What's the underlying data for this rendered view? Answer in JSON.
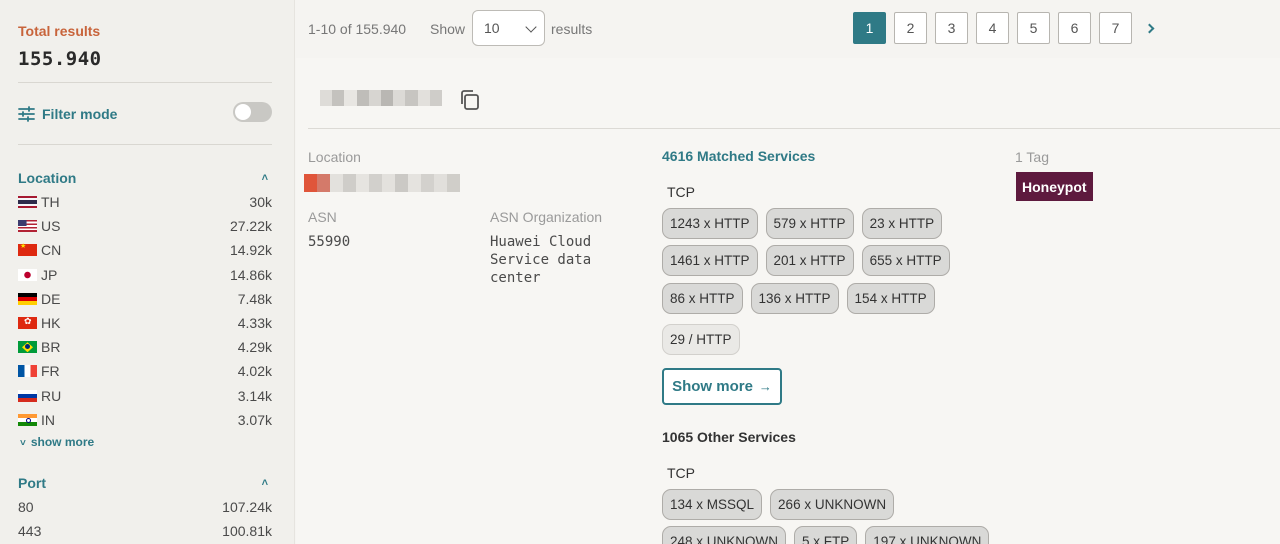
{
  "sidebar": {
    "total_label": "Total results",
    "total_value": "155.940",
    "filter_mode_label": "Filter mode",
    "location": {
      "title": "Location",
      "items": [
        {
          "code": "TH",
          "count": "30k",
          "flag": "fl-th"
        },
        {
          "code": "US",
          "count": "27.22k",
          "flag": "fl-us"
        },
        {
          "code": "CN",
          "count": "14.92k",
          "flag": "fl-cn"
        },
        {
          "code": "JP",
          "count": "14.86k",
          "flag": "fl-jp"
        },
        {
          "code": "DE",
          "count": "7.48k",
          "flag": "fl-de"
        },
        {
          "code": "HK",
          "count": "4.33k",
          "flag": "fl-hk"
        },
        {
          "code": "BR",
          "count": "4.29k",
          "flag": "fl-br"
        },
        {
          "code": "FR",
          "count": "4.02k",
          "flag": "fl-fr"
        },
        {
          "code": "RU",
          "count": "3.14k",
          "flag": "fl-ru"
        },
        {
          "code": "IN",
          "count": "3.07k",
          "flag": "fl-in"
        }
      ],
      "show_more": "show more"
    },
    "port": {
      "title": "Port",
      "items": [
        {
          "code": "80",
          "count": "107.24k"
        },
        {
          "code": "443",
          "count": "100.81k"
        }
      ]
    }
  },
  "toolbar": {
    "range": "1-10 of 155.940",
    "show_label": "Show",
    "per_page": "10",
    "results_label": "results",
    "pages": [
      "1",
      "2",
      "3",
      "4",
      "5",
      "6",
      "7"
    ],
    "current_page": "1"
  },
  "host": {
    "location_label": "Location",
    "asn_label": "ASN",
    "asn_value": "55990",
    "asn_org_label": "ASN Organization",
    "asn_org_value": [
      "Huawei Cloud",
      "Service data",
      "center"
    ],
    "matched_title": "4616 Matched Services",
    "matched_protocol": "TCP",
    "matched_rows": [
      [
        "1243 x HTTP",
        "579 x HTTP",
        "23 x HTTP"
      ],
      [
        "1461 x HTTP",
        "201 x HTTP",
        "655 x HTTP"
      ],
      [
        "86 x HTTP",
        "136 x HTTP",
        "154 x HTTP"
      ]
    ],
    "matched_extra": "29 / HTTP",
    "show_more_label": "Show more",
    "other_title": "1065 Other Services",
    "other_protocol": "TCP",
    "other_rows": [
      [
        "134 x MSSQL",
        "266 x UNKNOWN"
      ],
      [
        "248 x UNKNOWN",
        "5 x FTP",
        "197 x UNKNOWN"
      ]
    ],
    "tag_count_label": "1 Tag",
    "tags": [
      "Honeypot"
    ]
  },
  "colors": {
    "accent": "#2f7a86",
    "total_label": "#c8643b",
    "tag": "#5e1a3e"
  }
}
